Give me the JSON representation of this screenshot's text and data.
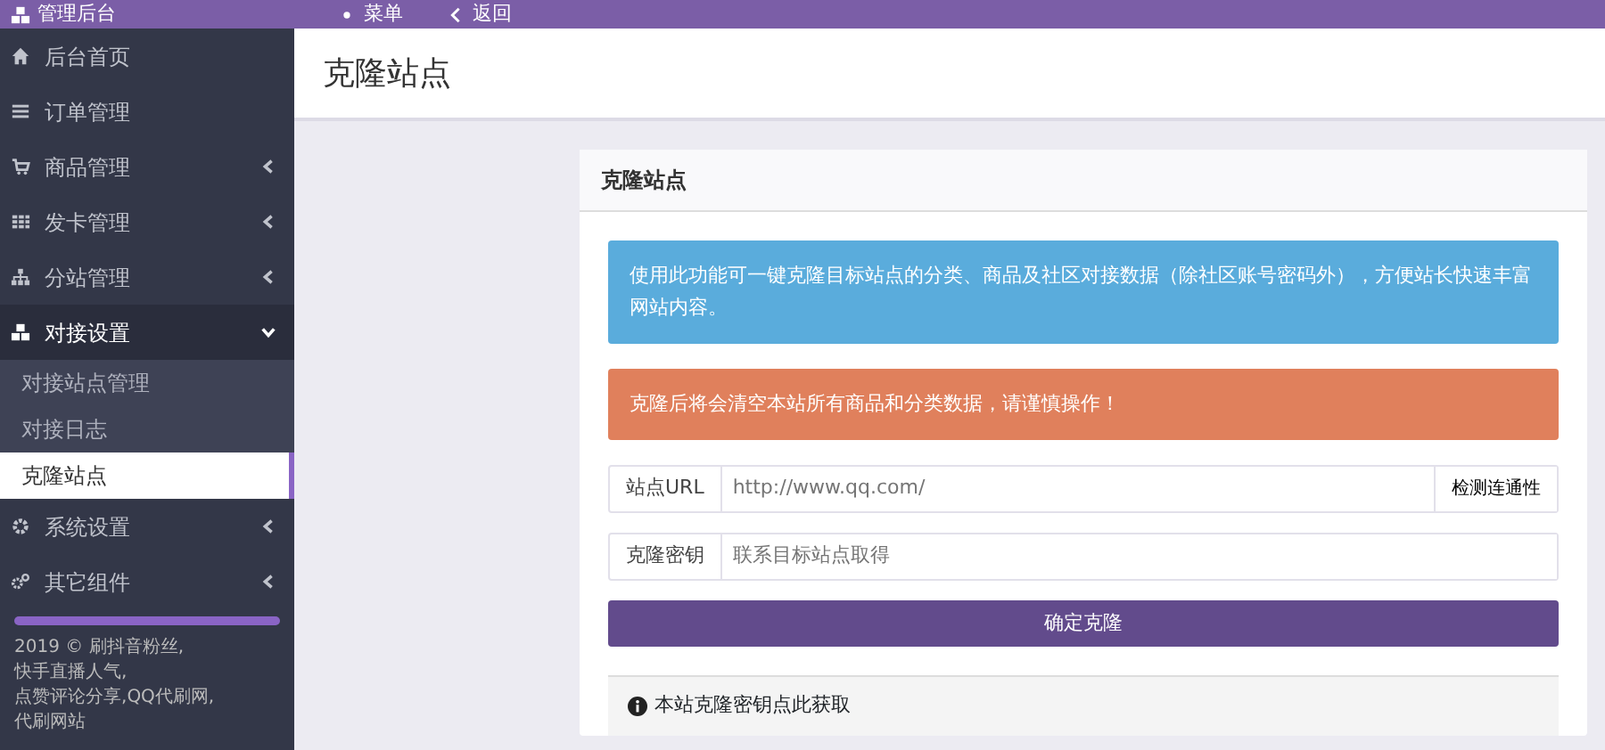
{
  "topbar": {
    "brand": "管理后台",
    "links": [
      {
        "label": "菜单"
      },
      {
        "label": "返回"
      }
    ]
  },
  "sidebar": {
    "items": [
      {
        "label": "后台首页",
        "kind": "link"
      },
      {
        "label": "订单管理",
        "kind": "link"
      },
      {
        "label": "商品管理",
        "kind": "menu",
        "expanded": false
      },
      {
        "label": "发卡管理",
        "kind": "menu",
        "expanded": false
      },
      {
        "label": "分站管理",
        "kind": "menu",
        "expanded": false
      },
      {
        "label": "对接设置",
        "kind": "menu",
        "expanded": true,
        "children": [
          {
            "label": "对接站点管理",
            "selected": false
          },
          {
            "label": "对接日志",
            "selected": false
          },
          {
            "label": "克隆站点",
            "selected": true
          }
        ]
      },
      {
        "label": "系统设置",
        "kind": "menu",
        "expanded": false
      },
      {
        "label": "其它组件",
        "kind": "menu",
        "expanded": false
      }
    ],
    "footer": {
      "year": "2019 ©",
      "links": [
        "刷抖音粉丝,",
        "快手直播人气,",
        "点赞评论分享,",
        "QQ代刷网,",
        "代刷网站"
      ]
    }
  },
  "page_title": "克隆站点",
  "card": {
    "title": "克隆站点",
    "alerts": [
      {
        "kind": "info",
        "text": "使用此功能可一键克隆目标站点的分类、商品及社区对接数据（除社区账号密码外），方便站长快速丰富网站内容。"
      },
      {
        "kind": "warning",
        "text": "克隆后将会清空本站所有商品和分类数据，请谨慎操作！"
      }
    ],
    "fields": [
      {
        "label": "站点URL",
        "placeholder": "http://www.qq.com/",
        "button": "检测连通性"
      },
      {
        "label": "克隆密钥",
        "placeholder": "联系目标站点取得"
      }
    ],
    "submit": "确定克隆",
    "footer": {
      "text": "本站克隆密钥",
      "link": "点此获取"
    }
  }
}
